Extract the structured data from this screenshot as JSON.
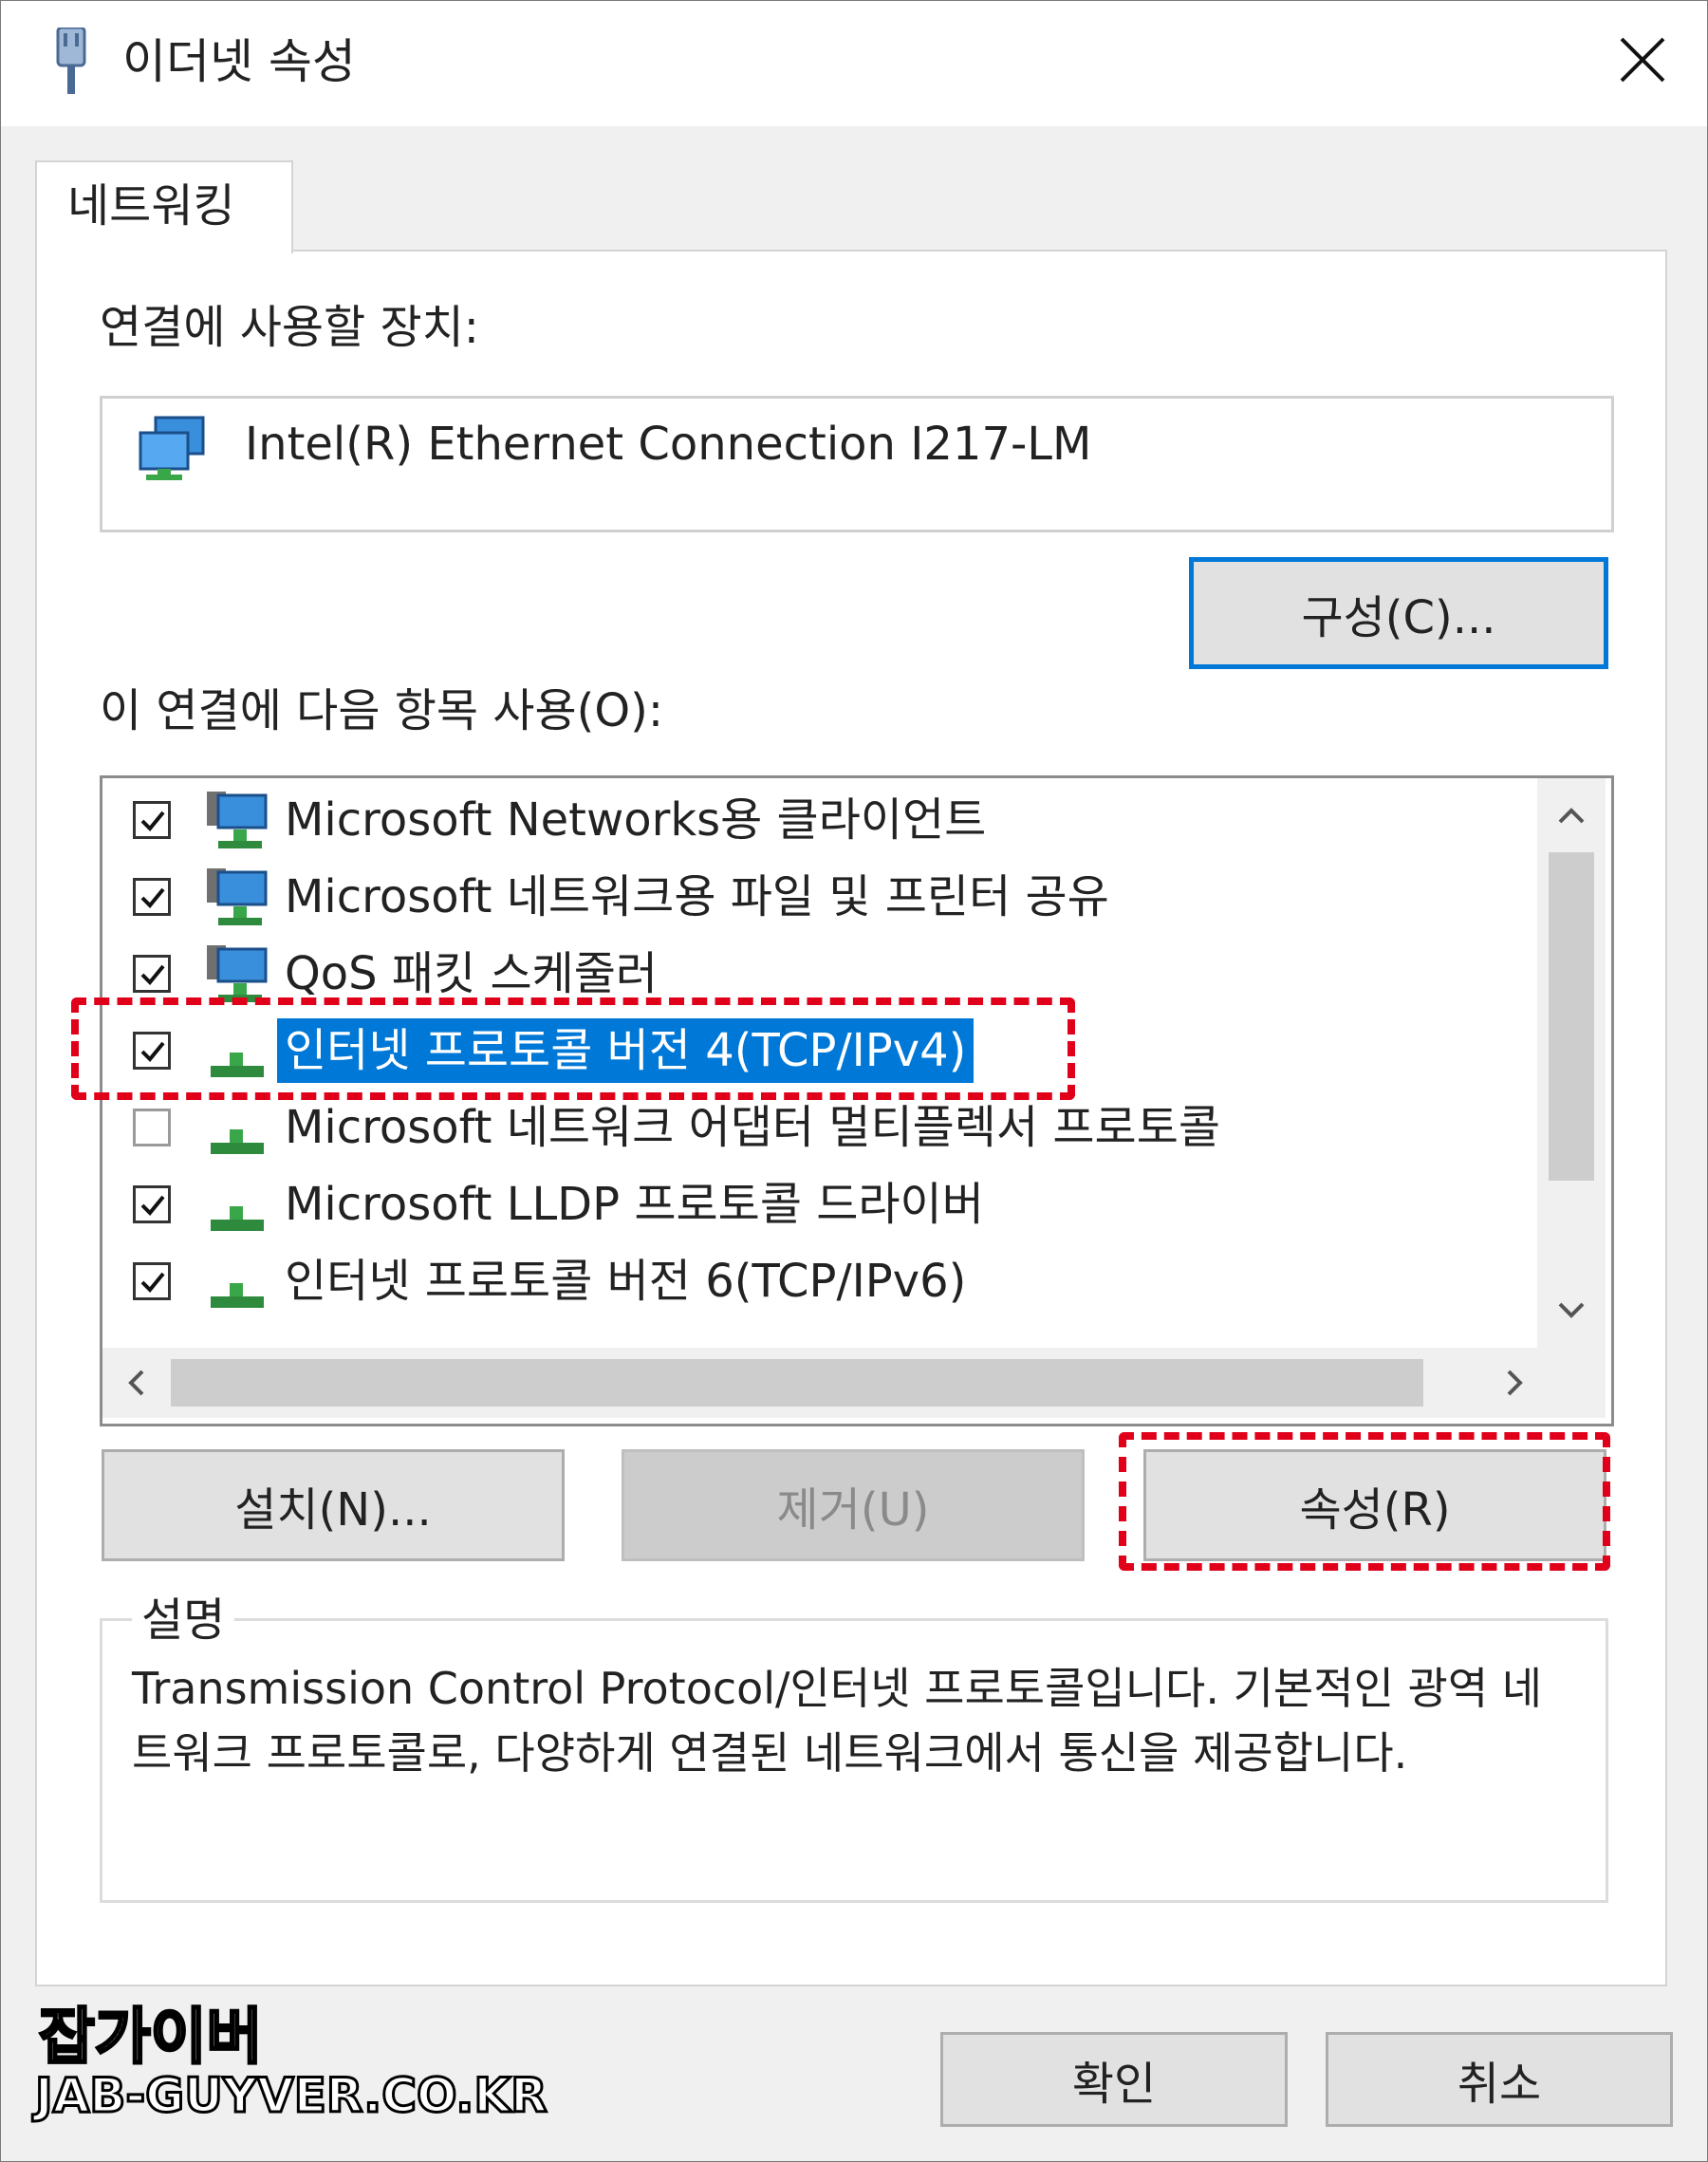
{
  "window": {
    "title": "이더넷 속성",
    "close_glyph": "✕"
  },
  "tabs": [
    {
      "label": "네트워킹"
    }
  ],
  "connect_using": {
    "label": "연결에 사용할 장치:",
    "device_name": "Intel(R) Ethernet Connection I217-LM",
    "configure_button": "구성(C)..."
  },
  "items": {
    "label": "이 연결에 다음 항목 사용(O):",
    "list": [
      {
        "label": "Microsoft Networks용 클라이언트",
        "checked": true,
        "icon": "network-client-icon"
      },
      {
        "label": "Microsoft 네트워크용 파일 및 프린터 공유",
        "checked": true,
        "icon": "network-service-icon"
      },
      {
        "label": "QoS 패킷 스케줄러",
        "checked": true,
        "icon": "network-service-icon"
      },
      {
        "label": "인터넷 프로토콜 버전 4(TCP/IPv4)",
        "checked": true,
        "icon": "network-protocol-icon",
        "selected": true
      },
      {
        "label": "Microsoft 네트워크 어댑터 멀티플렉서 프로토콜",
        "checked": false,
        "icon": "network-protocol-icon"
      },
      {
        "label": "Microsoft LLDP 프로토콜 드라이버",
        "checked": true,
        "icon": "network-protocol-icon"
      },
      {
        "label": "인터넷 프로토콜 버전 6(TCP/IPv6)",
        "checked": true,
        "icon": "network-protocol-icon"
      }
    ]
  },
  "buttons": {
    "install": "설치(N)...",
    "uninstall": "제거(U)",
    "properties": "속성(R)",
    "ok": "확인",
    "cancel": "취소"
  },
  "description": {
    "legend": "설명",
    "text": "Transmission Control Protocol/인터넷 프로토콜입니다. 기본적인 광역 네트워크 프로토콜로, 다양하게 연결된 네트워크에서 통신을 제공합니다."
  },
  "watermark": {
    "line1": "잡가이버",
    "line2": "JAB-GUYVER.CO.KR"
  },
  "colors": {
    "selection": "#0078d7",
    "highlight_dash": "#e0001a",
    "focus_border": "#0078d7"
  }
}
